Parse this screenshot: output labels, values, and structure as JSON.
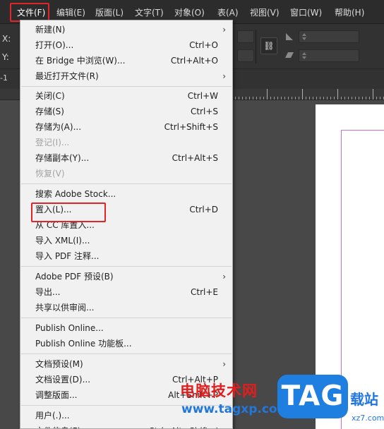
{
  "menubar": {
    "items": [
      {
        "label": "文件(F)",
        "active": true
      },
      {
        "label": "编辑(E)"
      },
      {
        "label": "版面(L)"
      },
      {
        "label": "文字(T)"
      },
      {
        "label": "对象(O)"
      },
      {
        "label": "表(A)"
      },
      {
        "label": "视图(V)"
      },
      {
        "label": "窗口(W)"
      },
      {
        "label": "帮助(H)"
      }
    ]
  },
  "controlbar": {
    "x_label": "X:",
    "y_label": "Y:",
    "link_glyph": "⛓"
  },
  "ruler": {
    "left_tag": "-1"
  },
  "file_menu": {
    "items": [
      {
        "label": "新建(N)",
        "shortcut": "",
        "submenu": true
      },
      {
        "label": "打开(O)...",
        "shortcut": "Ctrl+O"
      },
      {
        "label": "在 Bridge 中浏览(W)...",
        "shortcut": "Ctrl+Alt+O"
      },
      {
        "label": "最近打开文件(R)",
        "shortcut": "",
        "submenu": true
      },
      {
        "label": "关闭(C)",
        "shortcut": "Ctrl+W"
      },
      {
        "label": "存储(S)",
        "shortcut": "Ctrl+S"
      },
      {
        "label": "存储为(A)...",
        "shortcut": "Ctrl+Shift+S"
      },
      {
        "label": "登记(I)...",
        "shortcut": "",
        "disabled": true
      },
      {
        "label": "存储副本(Y)...",
        "shortcut": "Ctrl+Alt+S"
      },
      {
        "label": "恢复(V)",
        "shortcut": "",
        "disabled": true
      },
      {
        "label": "搜索 Adobe Stock...",
        "shortcut": ""
      },
      {
        "label": "置入(L)...",
        "shortcut": "Ctrl+D"
      },
      {
        "label": "从 CC 库置入...",
        "shortcut": ""
      },
      {
        "label": "导入 XML(I)...",
        "shortcut": ""
      },
      {
        "label": "导入 PDF 注释...",
        "shortcut": ""
      },
      {
        "label": "Adobe PDF 预设(B)",
        "shortcut": "",
        "submenu": true
      },
      {
        "label": "导出...",
        "shortcut": "Ctrl+E"
      },
      {
        "label": "共享以供审阅...",
        "shortcut": ""
      },
      {
        "label": "Publish Online...",
        "shortcut": ""
      },
      {
        "label": "Publish Online 功能板...",
        "shortcut": ""
      },
      {
        "label": "文档预设(M)",
        "shortcut": "",
        "submenu": true
      },
      {
        "label": "文档设置(D)...",
        "shortcut": "Ctrl+Alt+P"
      },
      {
        "label": "调整版面...",
        "shortcut": "Alt+Shift+P"
      },
      {
        "label": "用户(.)...",
        "shortcut": ""
      },
      {
        "label": "文件信息(F)...",
        "shortcut": "Ctrl+Alt+Shift+I"
      }
    ],
    "submenu_arrow": "›"
  },
  "watermark": {
    "cn_text": "电脑技术网",
    "url": "www.tagxp.com",
    "logo": "TAG",
    "side_text": "载站",
    "side_small": "xz7.com"
  },
  "colors": {
    "highlight_red": "#e0262b",
    "menu_bg": "#f1f1f1",
    "app_bg": "#323232"
  }
}
